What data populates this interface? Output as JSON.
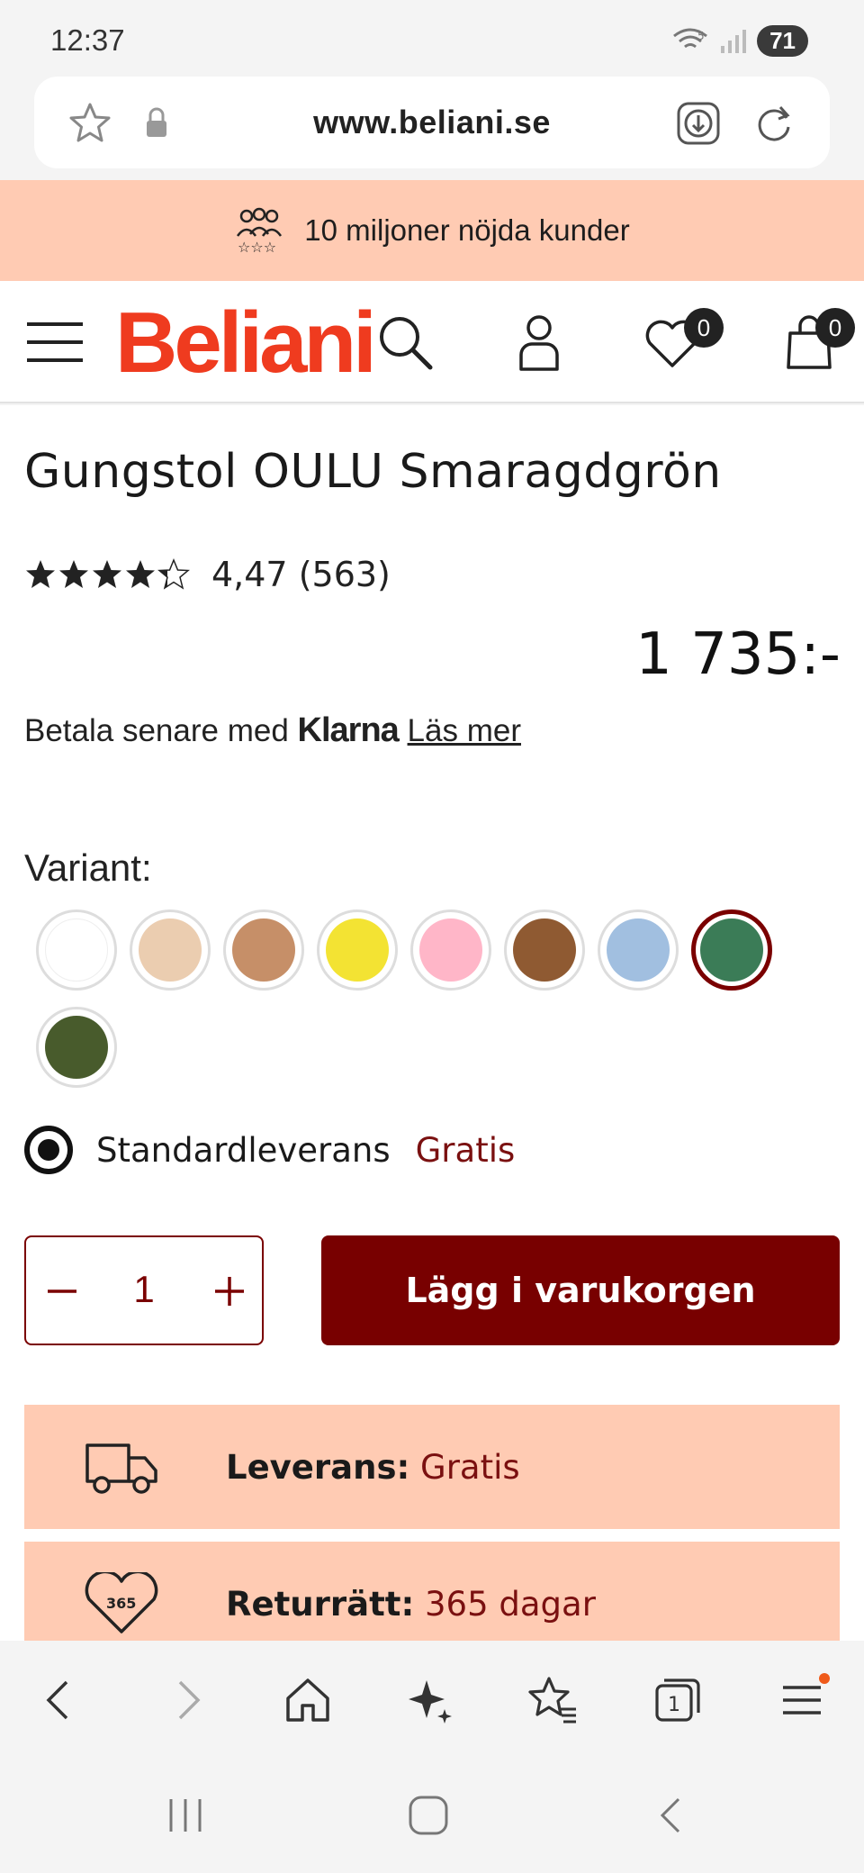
{
  "status": {
    "time": "12:37",
    "battery": "71",
    "signal_label": "5"
  },
  "browser": {
    "url": "www.beliani.se"
  },
  "promo": {
    "text": "10 miljoner nöjda kunder"
  },
  "header": {
    "logo": "Beliani",
    "wishlist_count": "0",
    "cart_count": "0"
  },
  "product": {
    "title": "Gungstol OULU Smaragdgrön",
    "rating_text": "4,47 (563)",
    "rating_value": 4.47,
    "rating_max": 5,
    "price": "1 735:-",
    "klarna_prefix": "Betala senare med",
    "klarna_brand": "Klarna",
    "klarna_link": "Läs mer",
    "variant_label": "Variant:",
    "variants": [
      {
        "name": "white",
        "color": "#ffffff"
      },
      {
        "name": "beige",
        "color": "#ebcdb0"
      },
      {
        "name": "tan",
        "color": "#c68f68"
      },
      {
        "name": "yellow",
        "color": "#f3e333"
      },
      {
        "name": "pink",
        "color": "#ffb6c8"
      },
      {
        "name": "brown",
        "color": "#8f5a32"
      },
      {
        "name": "light-blue",
        "color": "#a1bfe0"
      },
      {
        "name": "emerald-green",
        "color": "#3b7c57",
        "selected": true
      },
      {
        "name": "dark-green",
        "color": "#485b2c"
      }
    ],
    "delivery_option": "Standardleverans",
    "delivery_price": "Gratis",
    "quantity": "1",
    "add_to_cart": "Lägg i varukorgen"
  },
  "info": [
    {
      "label": "Leverans:",
      "value": "Gratis",
      "icon": "truck-icon"
    },
    {
      "label": "Returrätt:",
      "value": "365 dagar",
      "icon": "heart-365-icon",
      "icon_text": "365"
    }
  ],
  "colors": {
    "brand": "#ef3b1f",
    "accent": "#780000",
    "promo_bg": "#ffcbb3"
  }
}
